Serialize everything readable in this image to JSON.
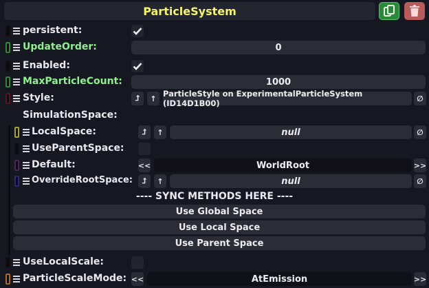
{
  "header": {
    "title": "ParticleSystem",
    "duplicate_icon": "duplicate-icon",
    "delete_icon": "trash-icon"
  },
  "colors": {
    "title": "#f5f56a",
    "green_label": "#8ef08e",
    "duplicate_bg": "#2a8a3a",
    "delete_bg": "#b85b5b"
  },
  "fields": {
    "persistent": {
      "label": "persistent:",
      "checked": true
    },
    "update_order": {
      "label": "UpdateOrder:",
      "value": "0"
    },
    "enabled": {
      "label": "Enabled:",
      "checked": true
    },
    "max_particle_count": {
      "label": "MaxParticleCount:",
      "value": "1000"
    },
    "style": {
      "label": "Style:",
      "value": "ParticleStyle on ExperimentalParticleSystem (ID14D1B00)",
      "clear": "∅"
    },
    "simulation_space": {
      "label": "SimulationSpace:"
    },
    "local_space": {
      "label": "LocalSpace:",
      "value": "null",
      "clear": "∅"
    },
    "use_parent_space": {
      "label": "UseParentSpace:",
      "checked": false
    },
    "default": {
      "label": "Default:",
      "value": "WorldRoot",
      "prev": "<<",
      "next": ">>"
    },
    "override_root_space": {
      "label": "OverrideRootSpace:",
      "value": "null",
      "clear": "∅"
    },
    "sync_header": "---- SYNC METHODS HERE ----",
    "use_global_space": "Use Global Space",
    "use_local_space": "Use Local Space",
    "use_parent_space_btn": "Use Parent Space",
    "use_local_scale": {
      "label": "UseLocalScale:",
      "checked": false
    },
    "particle_scale_mode": {
      "label": "ParticleScaleMode:",
      "value": "AtEmission",
      "prev": "<<",
      "next": ">>"
    }
  },
  "ref_buttons": {
    "jump": "⮥",
    "up": "↑"
  }
}
